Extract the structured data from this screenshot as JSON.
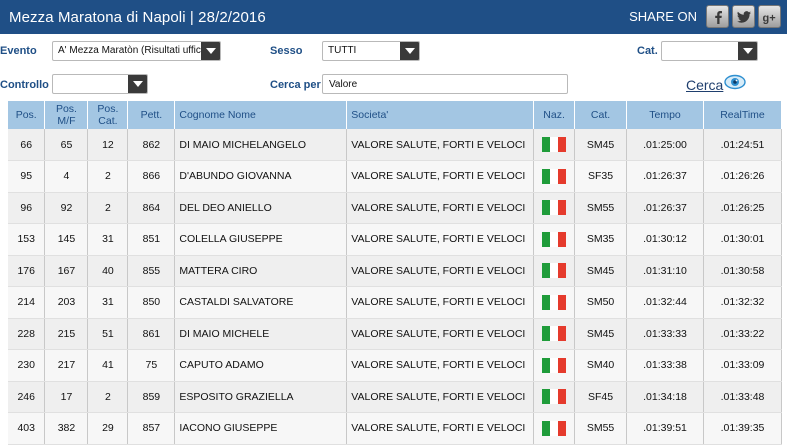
{
  "header": {
    "title": "Mezza Maratona di Napoli  |  28/2/2016",
    "share_label": "SHARE ON",
    "social": [
      {
        "icon": "facebook-icon",
        "glyph": "f"
      },
      {
        "icon": "twitter-icon",
        "glyph": "t"
      },
      {
        "icon": "google-plus-icon",
        "glyph": "g+"
      }
    ]
  },
  "filters": {
    "evento_label": "Evento",
    "evento_value": "A' Mezza Maratòn (Risultati ufficiosi)",
    "sesso_label": "Sesso",
    "sesso_value": "TUTTI",
    "cat_label": "Cat.",
    "cat_value": "",
    "controllo_label": "Controllo",
    "controllo_value": "",
    "cerca_per_label": "Cerca per",
    "cerca_per_value": "Valore",
    "cerca_button": "Cerca"
  },
  "table": {
    "columns": [
      "Pos.",
      "Pos. M/F",
      "Pos. Cat.",
      "Pett.",
      "Cognome Nome",
      "Societa'",
      "Naz.",
      "Cat.",
      "Tempo",
      "RealTime"
    ],
    "flag_colors": [
      "#1f9c3a",
      "#ffffff",
      "#e53a2c"
    ],
    "rows": [
      [
        "66",
        "65",
        "12",
        "862",
        "DI MAIO MICHELANGELO",
        "VALORE SALUTE, FORTI E VELOCI",
        "IT",
        "SM45",
        ".01:25:00",
        ".01:24:51"
      ],
      [
        "95",
        "4",
        "2",
        "866",
        "D'ABUNDO GIOVANNA",
        "VALORE SALUTE, FORTI E VELOCI",
        "IT",
        "SF35",
        ".01:26:37",
        ".01:26:26"
      ],
      [
        "96",
        "92",
        "2",
        "864",
        "DEL DEO ANIELLO",
        "VALORE SALUTE, FORTI E VELOCI",
        "IT",
        "SM55",
        ".01:26:37",
        ".01:26:25"
      ],
      [
        "153",
        "145",
        "31",
        "851",
        "COLELLA GIUSEPPE",
        "VALORE SALUTE, FORTI E VELOCI",
        "IT",
        "SM35",
        ".01:30:12",
        ".01:30:01"
      ],
      [
        "176",
        "167",
        "40",
        "855",
        "MATTERA CIRO",
        "VALORE SALUTE, FORTI E VELOCI",
        "IT",
        "SM45",
        ".01:31:10",
        ".01:30:58"
      ],
      [
        "214",
        "203",
        "31",
        "850",
        "CASTALDI SALVATORE",
        "VALORE SALUTE, FORTI E VELOCI",
        "IT",
        "SM50",
        ".01:32:44",
        ".01:32:32"
      ],
      [
        "228",
        "215",
        "51",
        "861",
        "DI MAIO MICHELE",
        "VALORE SALUTE, FORTI E VELOCI",
        "IT",
        "SM45",
        ".01:33:33",
        ".01:33:22"
      ],
      [
        "230",
        "217",
        "41",
        "75",
        "CAPUTO ADAMO",
        "VALORE SALUTE, FORTI E VELOCI",
        "IT",
        "SM40",
        ".01:33:38",
        ".01:33:09"
      ],
      [
        "246",
        "17",
        "2",
        "859",
        "ESPOSITO GRAZIELLA",
        "VALORE SALUTE, FORTI E VELOCI",
        "IT",
        "SF45",
        ".01:34:18",
        ".01:33:48"
      ],
      [
        "403",
        "382",
        "29",
        "857",
        "IACONO GIUSEPPE",
        "VALORE SALUTE, FORTI E VELOCI",
        "IT",
        "SM55",
        ".01:39:51",
        ".01:39:35"
      ]
    ]
  }
}
